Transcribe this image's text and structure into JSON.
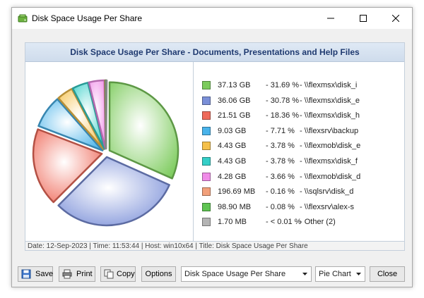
{
  "window": {
    "title": "Disk Space Usage Per Share"
  },
  "report": {
    "header": "Disk Space Usage Per Share - Documents, Presentations and Help Files",
    "footer": "Date: 12-Sep-2023 | Time: 11:53:44 | Host: win10x64 | Title: Disk Space Usage Per Share"
  },
  "chart_data": {
    "type": "pie",
    "slices": [
      {
        "size": "37.13 GB",
        "percent": "- 31.69 %",
        "share": "- \\\\flexmsx\\disk_i",
        "value": 31.69,
        "color": "#7ccb5c"
      },
      {
        "size": "36.06 GB",
        "percent": "- 30.78 %",
        "share": "- \\\\flexmsx\\disk_e",
        "value": 30.78,
        "color": "#7a8fd8"
      },
      {
        "size": "21.51 GB",
        "percent": "- 18.36 %",
        "share": "- \\\\flexmsx\\disk_h",
        "value": 18.36,
        "color": "#ef6a5a"
      },
      {
        "size": "9.03 GB",
        "percent": "- 7.71 %",
        "share": "- \\\\flexsrv\\backup",
        "value": 7.71,
        "color": "#49b3ea"
      },
      {
        "size": "4.43 GB",
        "percent": "- 3.78 %",
        "share": "- \\\\flexmob\\disk_e",
        "value": 3.78,
        "color": "#f5c04a"
      },
      {
        "size": "4.43 GB",
        "percent": "- 3.78 %",
        "share": "- \\\\flexmsx\\disk_f",
        "value": 3.78,
        "color": "#35cfc8"
      },
      {
        "size": "4.28 GB",
        "percent": "- 3.66 %",
        "share": "- \\\\flexmob\\disk_d",
        "value": 3.66,
        "color": "#f08ce8"
      },
      {
        "size": "196.69 MB",
        "percent": "- 0.16 %",
        "share": "- \\\\sqlsrv\\disk_d",
        "value": 0.16,
        "color": "#f2a07a"
      },
      {
        "size": "98.90 MB",
        "percent": "- 0.08 %",
        "share": "- \\\\flexsrv\\alex-s",
        "value": 0.08,
        "color": "#5fc452"
      },
      {
        "size": "1.70 MB",
        "percent": "- < 0.01 %",
        "share": "- Other (2)",
        "value": 0.001,
        "color": "#b4b4b4"
      }
    ]
  },
  "toolbar": {
    "save_label": "Save",
    "print_label": "Print",
    "copy_label": "Copy",
    "options_label": "Options",
    "report_select": "Disk Space Usage Per Share",
    "chart_select": "Pie Chart",
    "close_label": "Close"
  },
  "icons": {
    "app": "disk-icon",
    "minimize": "minimize-icon",
    "maximize": "maximize-icon",
    "close": "close-icon",
    "save": "floppy-icon",
    "print": "printer-icon",
    "copy": "copy-icon"
  }
}
